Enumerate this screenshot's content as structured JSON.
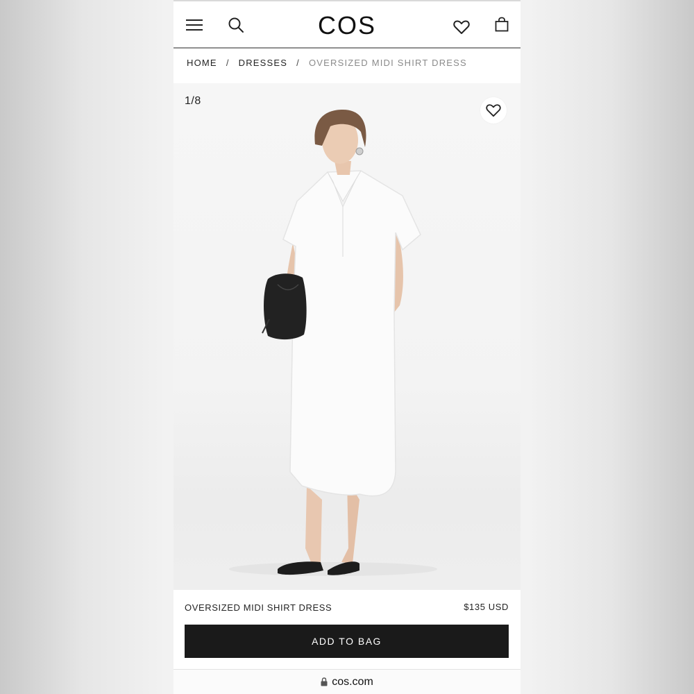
{
  "header": {
    "logo": "COS",
    "menu_icon": "hamburger-menu-icon",
    "search_icon": "search-icon",
    "favorite_icon": "heart-icon",
    "bag_icon": "shopping-bag-icon"
  },
  "breadcrumb": {
    "items": [
      "HOME",
      "DRESSES"
    ],
    "separator": "/",
    "current": "OVERSIZED MIDI SHIRT DRESS"
  },
  "gallery": {
    "counter": "1/8",
    "favorite_icon": "heart-icon"
  },
  "product": {
    "name": "OVERSIZED MIDI SHIRT DRESS",
    "price": "$135 USD"
  },
  "actions": {
    "add_to_bag": "ADD TO BAG"
  },
  "browser": {
    "url": "cos.com",
    "lock_icon": "lock-icon"
  },
  "colors": {
    "primary_button": "#1a1a1a",
    "text": "#222222",
    "muted_text": "#8a8a8a"
  }
}
